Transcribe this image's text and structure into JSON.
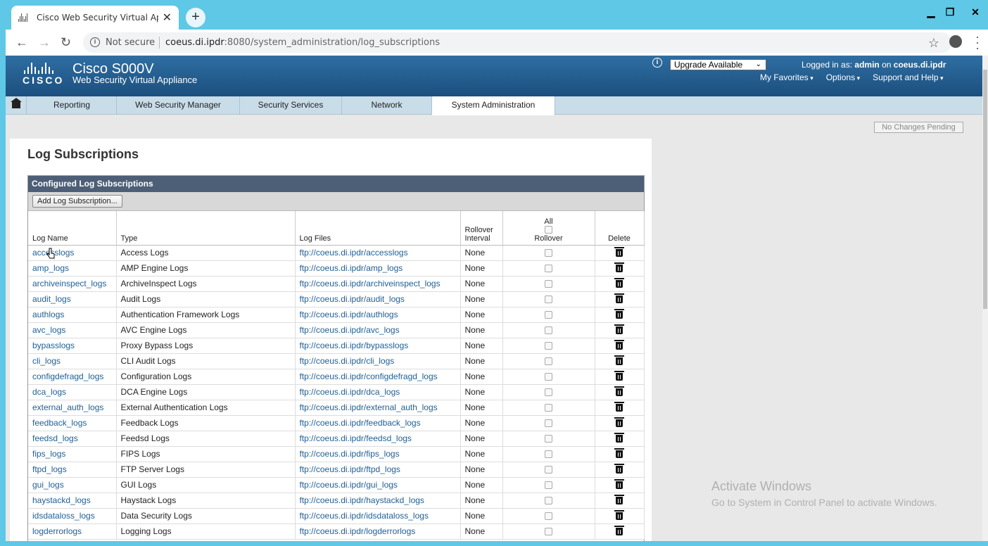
{
  "browser": {
    "tab_title": "Cisco Web Security Virtual Applia",
    "url_security": "Not secure",
    "url_host": "coeus.di.ipdr",
    "url_path": ":8080/system_administration/log_subscriptions",
    "icons": [
      "back-icon",
      "forward-icon",
      "reload-icon",
      "info-icon",
      "star-icon",
      "profile-icon",
      "menu-icon"
    ]
  },
  "header": {
    "brand": "CISCO",
    "product_name": "Cisco S000V",
    "product_sub": "Web Security Virtual Appliance",
    "upgrade_label": "Upgrade Available",
    "logged_prefix": "Logged in as:",
    "user": "admin",
    "on_text": "on",
    "host": "coeus.di.ipdr",
    "links": [
      "My Favorites",
      "Options",
      "Support and Help"
    ]
  },
  "nav": {
    "items": [
      "Reporting",
      "Web Security Manager",
      "Security Services",
      "Network",
      "System Administration"
    ],
    "active": "System Administration"
  },
  "status": {
    "pending": "No Changes Pending"
  },
  "page": {
    "title": "Log Subscriptions",
    "panel_title": "Configured Log Subscriptions",
    "add_button": "Add Log Subscription...",
    "columns": {
      "name": "Log Name",
      "type": "Type",
      "files": "Log Files",
      "rollover_interval_1": "Rollover",
      "rollover_interval_2": "Interval",
      "all": "All",
      "rollover": "Rollover",
      "delete": "Delete"
    },
    "rows": [
      {
        "name": "accesslogs",
        "type": "Access Logs",
        "files": "ftp://coeus.di.ipdr/accesslogs",
        "interval": "None"
      },
      {
        "name": "amp_logs",
        "type": "AMP Engine Logs",
        "files": "ftp://coeus.di.ipdr/amp_logs",
        "interval": "None"
      },
      {
        "name": "archiveinspect_logs",
        "type": "ArchiveInspect Logs",
        "files": "ftp://coeus.di.ipdr/archiveinspect_logs",
        "interval": "None"
      },
      {
        "name": "audit_logs",
        "type": "Audit Logs",
        "files": "ftp://coeus.di.ipdr/audit_logs",
        "interval": "None"
      },
      {
        "name": "authlogs",
        "type": "Authentication Framework Logs",
        "files": "ftp://coeus.di.ipdr/authlogs",
        "interval": "None"
      },
      {
        "name": "avc_logs",
        "type": "AVC Engine Logs",
        "files": "ftp://coeus.di.ipdr/avc_logs",
        "interval": "None"
      },
      {
        "name": "bypasslogs",
        "type": "Proxy Bypass Logs",
        "files": "ftp://coeus.di.ipdr/bypasslogs",
        "interval": "None"
      },
      {
        "name": "cli_logs",
        "type": "CLI Audit Logs",
        "files": "ftp://coeus.di.ipdr/cli_logs",
        "interval": "None"
      },
      {
        "name": "configdefragd_logs",
        "type": "Configuration Logs",
        "files": "ftp://coeus.di.ipdr/configdefragd_logs",
        "interval": "None"
      },
      {
        "name": "dca_logs",
        "type": "DCA Engine Logs",
        "files": "ftp://coeus.di.ipdr/dca_logs",
        "interval": "None"
      },
      {
        "name": "external_auth_logs",
        "type": "External Authentication Logs",
        "files": "ftp://coeus.di.ipdr/external_auth_logs",
        "interval": "None"
      },
      {
        "name": "feedback_logs",
        "type": "Feedback Logs",
        "files": "ftp://coeus.di.ipdr/feedback_logs",
        "interval": "None"
      },
      {
        "name": "feedsd_logs",
        "type": "Feedsd Logs",
        "files": "ftp://coeus.di.ipdr/feedsd_logs",
        "interval": "None"
      },
      {
        "name": "fips_logs",
        "type": "FIPS Logs",
        "files": "ftp://coeus.di.ipdr/fips_logs",
        "interval": "None"
      },
      {
        "name": "ftpd_logs",
        "type": "FTP Server Logs",
        "files": "ftp://coeus.di.ipdr/ftpd_logs",
        "interval": "None"
      },
      {
        "name": "gui_logs",
        "type": "GUI Logs",
        "files": "ftp://coeus.di.ipdr/gui_logs",
        "interval": "None"
      },
      {
        "name": "haystackd_logs",
        "type": "Haystack Logs",
        "files": "ftp://coeus.di.ipdr/haystackd_logs",
        "interval": "None"
      },
      {
        "name": "idsdataloss_logs",
        "type": "Data Security Logs",
        "files": "ftp://coeus.di.ipdr/idsdataloss_logs",
        "interval": "None"
      },
      {
        "name": "logderrorlogs",
        "type": "Logging Logs",
        "files": "ftp://coeus.di.ipdr/logderrorlogs",
        "interval": "None"
      }
    ]
  },
  "watermark": {
    "line1": "Activate Windows",
    "line2": "Go to System in Control Panel to activate Windows."
  },
  "colors": {
    "chrome_bg": "#5ec8e6",
    "header_blue": "#1b4f7e",
    "nav_bg": "#c9dde9",
    "panel_head": "#4d5f76",
    "link": "#1f5f94"
  }
}
